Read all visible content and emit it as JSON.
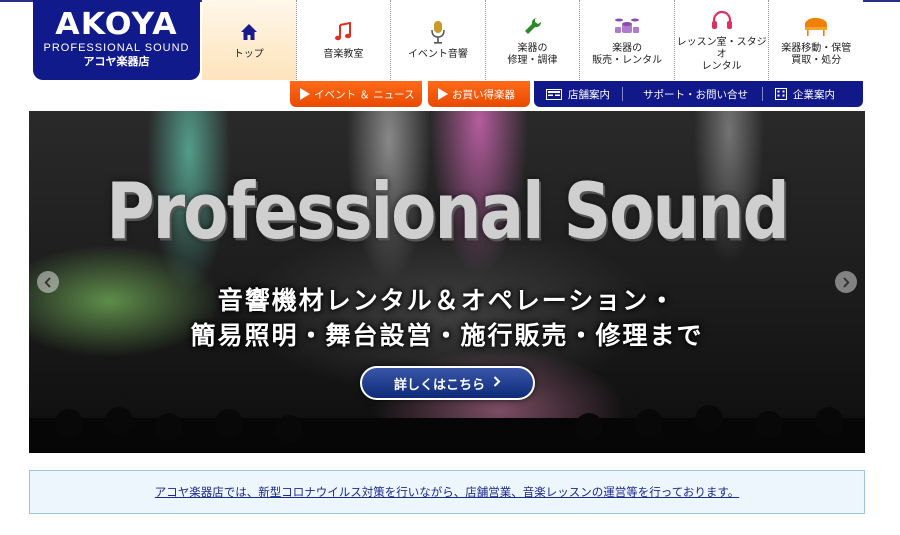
{
  "logo": {
    "brand": "AKOYA",
    "sub": "PROFESSIONAL SOUND",
    "jp": "アコヤ楽器店"
  },
  "nav": {
    "items": [
      {
        "label": "トップ",
        "icon": "home-icon",
        "active": true
      },
      {
        "label": "音楽教室",
        "icon": "music-note-icon"
      },
      {
        "label": "イベント音響",
        "icon": "microphone-icon"
      },
      {
        "label": "楽器の\n修理・調律",
        "icon": "wrench-icon"
      },
      {
        "label": "楽器の\n販売・レンタル",
        "icon": "drum-icon"
      },
      {
        "label": "レッスン室・スタジオ\nレンタル",
        "icon": "headphones-icon"
      },
      {
        "label": "楽器移動・保管\n買取・処分",
        "icon": "piano-icon"
      }
    ]
  },
  "subnav": {
    "events_news": "イベント ＆ ニュース",
    "deals": "お買い得楽器",
    "store_info": "店舗案内",
    "support_contact": "サポート・お問い合せ",
    "company_info": "企業案内"
  },
  "hero": {
    "headline": "Professional Sound",
    "line1": "音響機材レンタル＆オペレーション・",
    "line2": "簡易照明・舞台設営・施行販売・修理まで",
    "cta": "詳しくはこちら"
  },
  "notice": {
    "text": "アコヤ楽器店では、新型コロナウイルス対策を行いながら、店舗営業、音楽レッスンの運営等を行っております。"
  },
  "colors": {
    "brand_navy": "#111a8a",
    "accent_orange": "#f05a0a",
    "nav_icon_blue": "#1a1a8a",
    "nav_icon_red": "#e03020",
    "nav_icon_green": "#2a8a2a",
    "nav_icon_purple": "#8a4ab0",
    "nav_icon_orange": "#f08000"
  }
}
